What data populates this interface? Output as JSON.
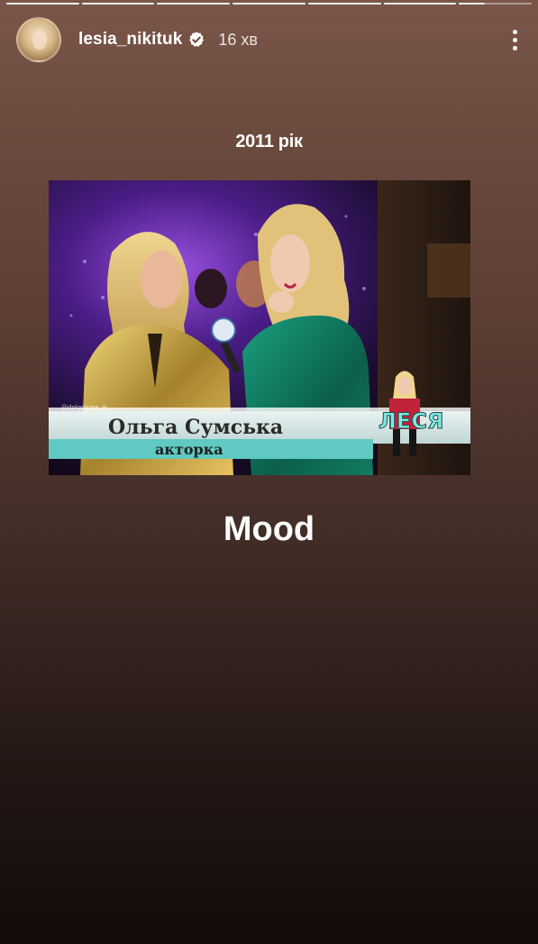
{
  "story": {
    "progress_segments": 7,
    "current_segment_fill_fraction": 0.35
  },
  "header": {
    "username": "lesia_nikituk",
    "verified": true,
    "time_ago": "16 хв",
    "avatar_icon": "avatar-icon",
    "menu_icon": "more-vertical-icon"
  },
  "content": {
    "caption_year": "2011 рік",
    "caption_bottom": "Mood",
    "photo": {
      "lower_third_name": "Ольга Сумська",
      "lower_third_role": "акторка",
      "show_logo": "ЛЕСЯ",
      "watermark": "@dolgrisme_ik"
    }
  },
  "colors": {
    "background_top": "#7a5649",
    "background_bottom": "#120b0a",
    "text": "#ffffff",
    "lower_third_teal": "#5fc9c2"
  }
}
